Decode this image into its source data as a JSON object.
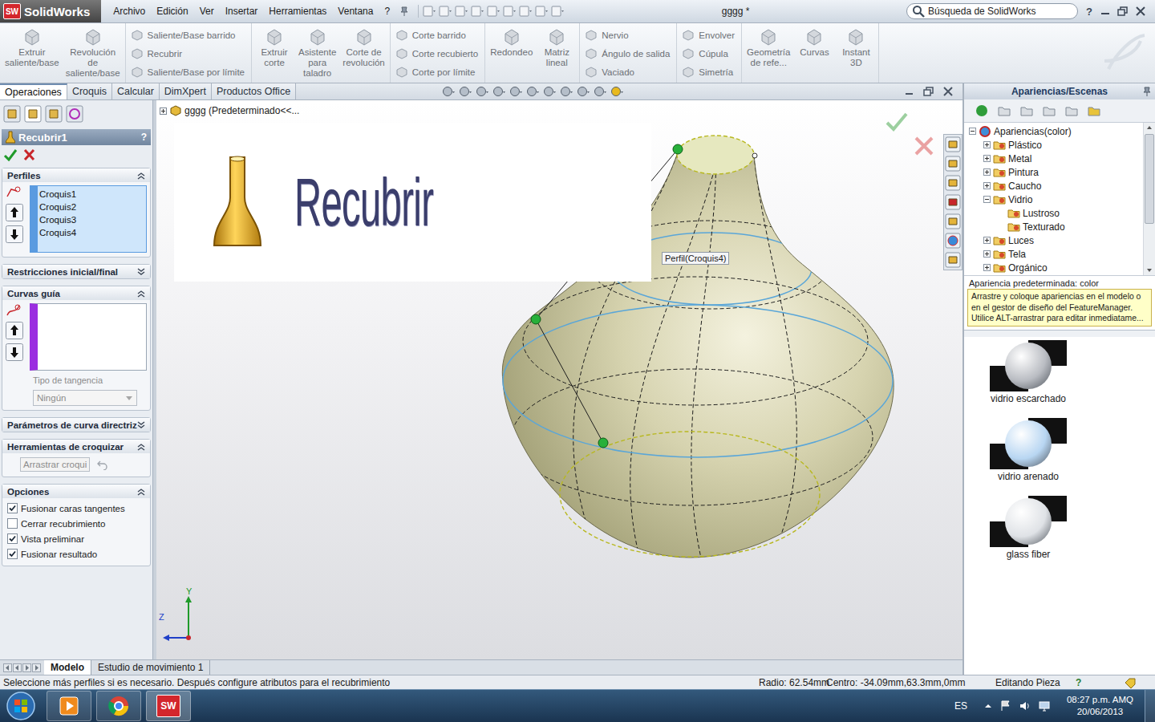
{
  "app": {
    "name": "SolidWorks",
    "badge": "SW"
  },
  "window": {
    "title": "gggg *"
  },
  "menu": [
    {
      "label": "Archivo"
    },
    {
      "label": "Edición"
    },
    {
      "label": "Ver"
    },
    {
      "label": "Insertar"
    },
    {
      "label": "Herramientas"
    },
    {
      "label": "Ventana"
    },
    {
      "label": "?"
    }
  ],
  "search": {
    "placeholder": "Búsqueda de SolidWorks"
  },
  "title_help": "?",
  "ribbon": {
    "disabled": true,
    "groups": [
      {
        "kind": "big",
        "items": [
          "Extruir saliente/base",
          "Revolución de saliente/base"
        ]
      },
      {
        "kind": "stack",
        "items": [
          "Saliente/Base barrido",
          "Recubrir",
          "Saliente/Base por límite"
        ]
      },
      {
        "kind": "big",
        "items": [
          "Extruir corte",
          "Asistente para taladro",
          "Corte de revolución"
        ]
      },
      {
        "kind": "stack",
        "items": [
          "Corte barrido",
          "Corte recubierto",
          "Corte por límite"
        ]
      },
      {
        "kind": "big",
        "items": [
          "Redondeo",
          "Matriz lineal"
        ]
      },
      {
        "kind": "stack",
        "items": [
          "Nervio",
          "Ángulo de salida",
          "Vaciado"
        ]
      },
      {
        "kind": "stack",
        "items": [
          "Envolver",
          "Cúpula",
          "Simetría"
        ]
      },
      {
        "kind": "big",
        "items": [
          "Geometría de refe...",
          "Curvas",
          "Instant 3D"
        ]
      }
    ]
  },
  "command_tabs": [
    {
      "label": "Operaciones",
      "selected": true
    },
    {
      "label": "Croquis",
      "selected": false
    },
    {
      "label": "Calcular",
      "selected": false
    },
    {
      "label": "DimXpert",
      "selected": false
    },
    {
      "label": "Productos Office",
      "selected": false
    }
  ],
  "feature_tree": {
    "label": "gggg  (Predeterminado<<..."
  },
  "property_manager": {
    "title": "Recubrir1",
    "help": "?",
    "profiles": {
      "title": "Perfiles",
      "expanded": true,
      "active": true,
      "items": [
        {
          "label": "Croquis1",
          "selected": false
        },
        {
          "label": "Croquis2",
          "selected": false
        },
        {
          "label": "Croquis3",
          "selected": false
        },
        {
          "label": "Croquis4",
          "selected": false
        }
      ]
    },
    "end_constraints": {
      "title": "Restricciones inicial/final",
      "expanded": false
    },
    "guide_curves": {
      "title": "Curvas guía",
      "expanded": true,
      "items": [],
      "tangency_label": "Tipo de tangencia",
      "tangency_value": "Ningún",
      "disabled": true
    },
    "guide_params": {
      "title": "Parámetros de curva directriz",
      "expanded": false
    },
    "sketch_tools": {
      "title": "Herramientas de croquizar",
      "expanded": true,
      "button": "Arrastrar croqui",
      "disabled": true
    },
    "options": {
      "title": "Opciones",
      "expanded": true,
      "items": [
        {
          "label": "Fusionar caras tangentes",
          "checked": true
        },
        {
          "label": "Cerrar recubrimiento",
          "checked": false
        },
        {
          "label": "Vista preliminar",
          "checked": true
        },
        {
          "label": "Fusionar resultado",
          "checked": true
        }
      ]
    }
  },
  "overlay": {
    "title": "Recubrir"
  },
  "tooltip": "Perfil(Croquis4)",
  "triad": {
    "y": "Y",
    "z": "Z"
  },
  "task_pane": {
    "title": "Apariencias/Escenas",
    "tree": [
      {
        "label": "Apariencias(color)",
        "depth": 0,
        "kind": "folder",
        "expanded": true
      },
      {
        "label": "Plástico",
        "depth": 1,
        "kind": "folder",
        "expanded": false
      },
      {
        "label": "Metal",
        "depth": 1,
        "kind": "folder",
        "expanded": false
      },
      {
        "label": "Pintura",
        "depth": 1,
        "kind": "folder",
        "expanded": false
      },
      {
        "label": "Caucho",
        "depth": 1,
        "kind": "folder",
        "expanded": false
      },
      {
        "label": "Vidrio",
        "depth": 1,
        "kind": "folder",
        "expanded": true
      },
      {
        "label": "Lustroso",
        "depth": 2,
        "kind": "leaf",
        "expanded": false
      },
      {
        "label": "Texturado",
        "depth": 2,
        "kind": "leaf",
        "expanded": false
      },
      {
        "label": "Luces",
        "depth": 1,
        "kind": "folder",
        "expanded": false
      },
      {
        "label": "Tela",
        "depth": 1,
        "kind": "folder",
        "expanded": false
      },
      {
        "label": "Orgánico",
        "depth": 1,
        "kind": "folder",
        "expanded": false
      }
    ],
    "default_label": "Apariencia predeterminada: color",
    "hint": [
      "Arrastre y coloque apariencias en el modelo o",
      "en el gestor de diseño del FeatureManager.",
      "Utilice ALT-arrastrar para editar inmediatame..."
    ],
    "swatches": [
      {
        "label": "vidrio escarchado",
        "color": "#b9bcc2"
      },
      {
        "label": "vidrio arenado",
        "color": "#b8d6f2"
      },
      {
        "label": "glass fiber",
        "color": "#dfe2e6"
      }
    ]
  },
  "bottom_tabs": [
    {
      "label": "Modelo",
      "selected": true
    },
    {
      "label": "Estudio de movimiento 1",
      "selected": false
    }
  ],
  "status_bar": {
    "message": "Seleccione más perfiles si es necesario. Después configure atributos para el recubrimiento",
    "radius": "Radio: 62.54mm",
    "center": "Centro: -34.09mm,63.3mm,0mm",
    "mode": "Editando Pieza",
    "help": "?"
  },
  "taskbar": {
    "language": "ES",
    "time": "08:27 p.m. AMQ",
    "date": "20/06/2013"
  }
}
